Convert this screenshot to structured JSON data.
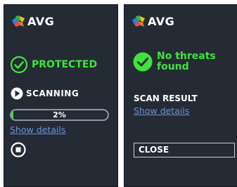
{
  "left_panel": {
    "logo_text": "AVG",
    "status_text": "PROTECTED",
    "scanning_label": "SCANNING",
    "progress": {
      "percent": 2,
      "label": "2%"
    },
    "show_details": "Show details"
  },
  "right_panel": {
    "logo_text": "AVG",
    "status_line1": "No threats",
    "status_line2": "found",
    "scan_result_label": "SCAN RESULT",
    "show_details": "Show details",
    "close_label": "CLOSE"
  },
  "colors": {
    "panel_bg": "#252b35",
    "status_green": "#3ee43a",
    "link_blue": "#6b93d6",
    "text_white": "#ffffff"
  }
}
